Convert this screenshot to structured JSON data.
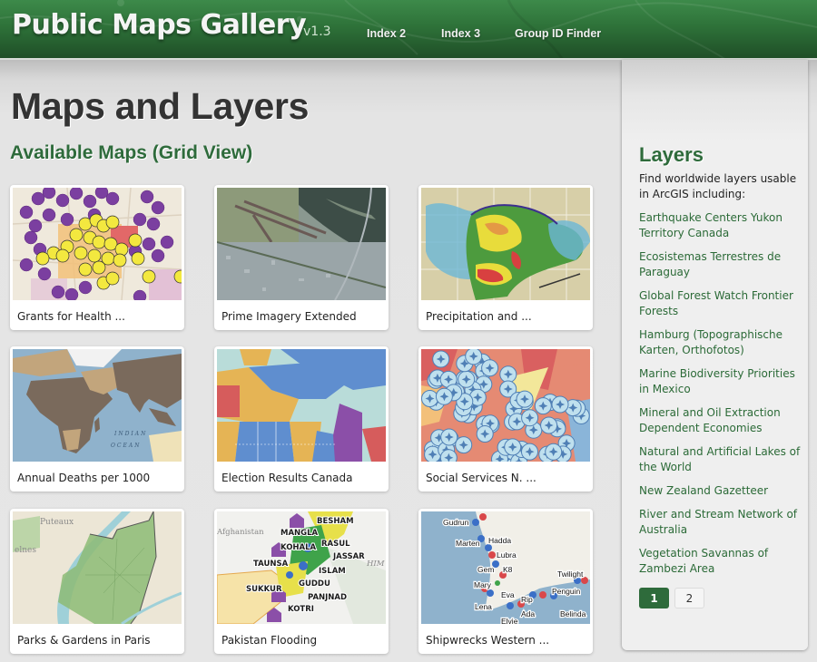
{
  "header": {
    "title": "Public Maps Gallery",
    "version": "v1.3",
    "nav": [
      {
        "label": "Index 2"
      },
      {
        "label": "Index 3"
      },
      {
        "label": "Group ID Finder"
      }
    ],
    "brand_color": "#2e7239"
  },
  "main": {
    "title": "Maps and Layers",
    "section_title": "Available Maps (Grid View)",
    "maps": [
      {
        "label": "Grants for Health ...",
        "thumbnail": "health-grants-dot-map"
      },
      {
        "label": "Prime Imagery Extended",
        "thumbnail": "aerial-imagery"
      },
      {
        "label": "Precipitation and ...",
        "thumbnail": "precipitation-radar"
      },
      {
        "label": "Annual Deaths per 1000",
        "thumbnail": "world-choropleth",
        "map_text": [
          "INDIAN",
          "OCEAN"
        ]
      },
      {
        "label": "Election Results Canada",
        "thumbnail": "canada-election-map"
      },
      {
        "label": "Social Services N. ...",
        "thumbnail": "social-services-cluster-map"
      },
      {
        "label": "Parks & Gardens in Paris",
        "thumbnail": "paris-parks-map",
        "map_text": [
          "Puteaux",
          "elnes"
        ]
      },
      {
        "label": "Pakistan Flooding",
        "thumbnail": "pakistan-flood-map",
        "map_text": [
          "Afghanistan",
          "BESHAM",
          "MANGLA",
          "RASUL",
          "KOHALA",
          "JASSAR",
          "TAUNSA",
          "ISLAM",
          "GUDDU",
          "SUKKUR",
          "PANJNAD",
          "KOTRI",
          "HIM"
        ]
      },
      {
        "label": "Shipwrecks Western ...",
        "thumbnail": "shipwrecks-map",
        "map_text": [
          "Gudrun",
          "Hadda",
          "Marten",
          "Lubra",
          "Gem",
          "K8",
          "Twilight",
          "Mary",
          "Penguin",
          "Eva",
          "Rip",
          "Lena",
          "Ada",
          "Belinda",
          "Elvie"
        ]
      }
    ]
  },
  "sidebar": {
    "title": "Layers",
    "description": "Find worldwide layers usable in ArcGIS including:",
    "layers": [
      "Earthquake Centers Yukon Territory Canada",
      "Ecosistemas Terrestres de Paraguay",
      "Global Forest Watch Frontier Forests",
      "Hamburg (Topographische Karten, Orthofotos)",
      "Marine Biodiversity Priorities in Mexico",
      "Mineral and Oil Extraction Dependent Economies",
      "Natural and Artificial Lakes of the World",
      "New Zealand Gazetteer",
      "River and Stream Network of Australia",
      "Vegetation Savannas of Zambezi Area"
    ],
    "pagination": {
      "pages": [
        "1",
        "2"
      ],
      "current": "1"
    },
    "accent_color": "#2e6b3b"
  }
}
